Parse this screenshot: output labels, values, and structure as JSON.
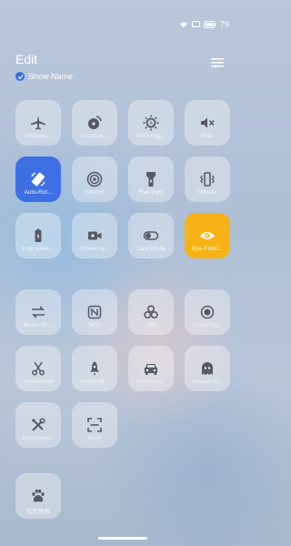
{
  "status": {
    "battery": "79"
  },
  "header": {
    "title": "Edit",
    "show_name": "Show Name"
  },
  "tiles": [
    {
      "label": "Airplane..."
    },
    {
      "label": "Location..."
    },
    {
      "label": "Auto-Brig..."
    },
    {
      "label": "Mute"
    },
    {
      "label": "Auto-Rot..."
    },
    {
      "label": "Hotspot"
    },
    {
      "label": "Flashlight"
    },
    {
      "label": "Vibrate"
    },
    {
      "label": "Low powe..."
    },
    {
      "label": "Screen re..."
    },
    {
      "label": "Dark Mode"
    },
    {
      "label": "Eye-Frien..."
    },
    {
      "label": "Meizu Sh..."
    },
    {
      "label": "NFC"
    },
    {
      "label": "VPN"
    },
    {
      "label": "SmartTou..."
    },
    {
      "label": "Screenshot"
    },
    {
      "label": "Accelerat..."
    },
    {
      "label": "Driving m..."
    },
    {
      "label": "Privacy m..."
    },
    {
      "label": "Developer..."
    },
    {
      "label": "Scan"
    },
    {
      "label": "百度搜索"
    }
  ],
  "icons": [
    "airplane-icon",
    "location-icon",
    "auto-brightness-icon",
    "mute-icon",
    "auto-rotate-icon",
    "hotspot-icon",
    "flashlight-icon",
    "vibrate-icon",
    "low-power-icon",
    "screen-record-icon",
    "dark-mode-icon",
    "eye-friendly-icon",
    "meizu-share-icon",
    "nfc-icon",
    "vpn-icon",
    "smarttouch-icon",
    "screenshot-icon",
    "accelerate-icon",
    "driving-mode-icon",
    "privacy-mode-icon",
    "developer-icon",
    "scan-icon",
    "baidu-search-icon"
  ],
  "colors": {
    "active_blue": "#3e70e4",
    "active_yellow": "#f7b315"
  }
}
